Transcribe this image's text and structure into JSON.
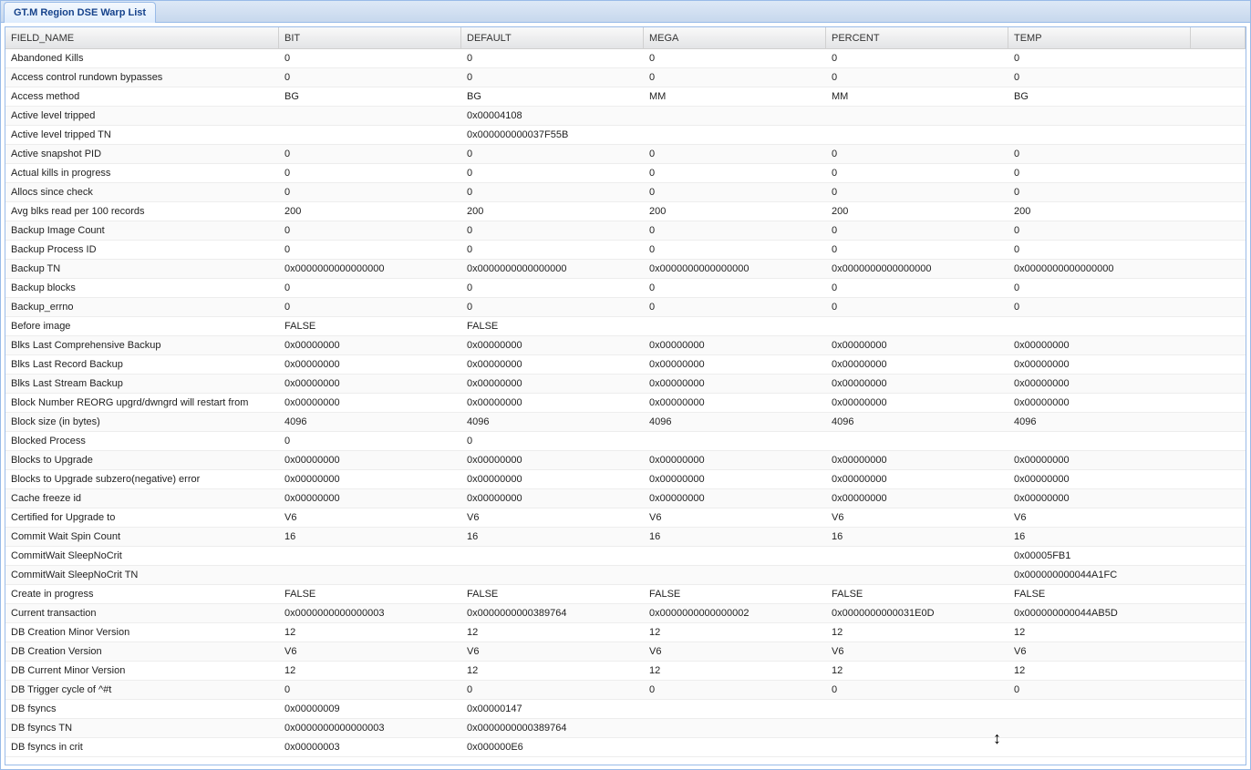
{
  "tab": {
    "title": "GT.M Region DSE Warp List"
  },
  "columns": [
    "FIELD_NAME",
    "BIT",
    "DEFAULT",
    "MEGA",
    "PERCENT",
    "TEMP"
  ],
  "rows": [
    {
      "f": "Abandoned Kills",
      "v": [
        "0",
        "0",
        "0",
        "0",
        "0"
      ]
    },
    {
      "f": "Access control rundown bypasses",
      "v": [
        "0",
        "0",
        "0",
        "0",
        "0"
      ]
    },
    {
      "f": "Access method",
      "v": [
        "BG",
        "BG",
        "MM",
        "MM",
        "BG"
      ]
    },
    {
      "f": "Active level tripped",
      "v": [
        "",
        "0x00004108",
        "",
        "",
        ""
      ]
    },
    {
      "f": "Active level tripped TN",
      "v": [
        "",
        "0x000000000037F55B",
        "",
        "",
        ""
      ]
    },
    {
      "f": "Active snapshot PID",
      "v": [
        "0",
        "0",
        "0",
        "0",
        "0"
      ]
    },
    {
      "f": "Actual kills in progress",
      "v": [
        "0",
        "0",
        "0",
        "0",
        "0"
      ]
    },
    {
      "f": "Allocs since check",
      "v": [
        "0",
        "0",
        "0",
        "0",
        "0"
      ]
    },
    {
      "f": "Avg blks read per 100 records",
      "v": [
        "200",
        "200",
        "200",
        "200",
        "200"
      ]
    },
    {
      "f": "Backup Image Count",
      "v": [
        "0",
        "0",
        "0",
        "0",
        "0"
      ]
    },
    {
      "f": "Backup Process ID",
      "v": [
        "0",
        "0",
        "0",
        "0",
        "0"
      ]
    },
    {
      "f": "Backup TN",
      "v": [
        "0x0000000000000000",
        "0x0000000000000000",
        "0x0000000000000000",
        "0x0000000000000000",
        "0x0000000000000000"
      ]
    },
    {
      "f": "Backup blocks",
      "v": [
        "0",
        "0",
        "0",
        "0",
        "0"
      ]
    },
    {
      "f": "Backup_errno",
      "v": [
        "0",
        "0",
        "0",
        "0",
        "0"
      ]
    },
    {
      "f": "Before image",
      "v": [
        "FALSE",
        "FALSE",
        "",
        "",
        ""
      ]
    },
    {
      "f": "Blks Last Comprehensive Backup",
      "v": [
        "0x00000000",
        "0x00000000",
        "0x00000000",
        "0x00000000",
        "0x00000000"
      ]
    },
    {
      "f": "Blks Last Record Backup",
      "v": [
        "0x00000000",
        "0x00000000",
        "0x00000000",
        "0x00000000",
        "0x00000000"
      ]
    },
    {
      "f": "Blks Last Stream Backup",
      "v": [
        "0x00000000",
        "0x00000000",
        "0x00000000",
        "0x00000000",
        "0x00000000"
      ]
    },
    {
      "f": "Block Number REORG upgrd/dwngrd will restart from",
      "v": [
        "0x00000000",
        "0x00000000",
        "0x00000000",
        "0x00000000",
        "0x00000000"
      ]
    },
    {
      "f": "Block size (in bytes)",
      "v": [
        "4096",
        "4096",
        "4096",
        "4096",
        "4096"
      ]
    },
    {
      "f": "Blocked Process",
      "v": [
        "0",
        "0",
        "",
        "",
        ""
      ]
    },
    {
      "f": "Blocks to Upgrade",
      "v": [
        "0x00000000",
        "0x00000000",
        "0x00000000",
        "0x00000000",
        "0x00000000"
      ]
    },
    {
      "f": "Blocks to Upgrade subzero(negative) error",
      "v": [
        "0x00000000",
        "0x00000000",
        "0x00000000",
        "0x00000000",
        "0x00000000"
      ]
    },
    {
      "f": "Cache freeze id",
      "v": [
        "0x00000000",
        "0x00000000",
        "0x00000000",
        "0x00000000",
        "0x00000000"
      ]
    },
    {
      "f": "Certified for Upgrade to",
      "v": [
        "V6",
        "V6",
        "V6",
        "V6",
        "V6"
      ]
    },
    {
      "f": "Commit Wait Spin Count",
      "v": [
        "16",
        "16",
        "16",
        "16",
        "16"
      ]
    },
    {
      "f": "CommitWait SleepNoCrit",
      "v": [
        "",
        "",
        "",
        "",
        "0x00005FB1"
      ]
    },
    {
      "f": "CommitWait SleepNoCrit TN",
      "v": [
        "",
        "",
        "",
        "",
        "0x000000000044A1FC"
      ]
    },
    {
      "f": "Create in progress",
      "v": [
        "FALSE",
        "FALSE",
        "FALSE",
        "FALSE",
        "FALSE"
      ]
    },
    {
      "f": "Current transaction",
      "v": [
        "0x0000000000000003",
        "0x0000000000389764",
        "0x0000000000000002",
        "0x0000000000031E0D",
        "0x000000000044AB5D"
      ]
    },
    {
      "f": "DB Creation Minor Version",
      "v": [
        "12",
        "12",
        "12",
        "12",
        "12"
      ]
    },
    {
      "f": "DB Creation Version",
      "v": [
        "V6",
        "V6",
        "V6",
        "V6",
        "V6"
      ]
    },
    {
      "f": "DB Current Minor Version",
      "v": [
        "12",
        "12",
        "12",
        "12",
        "12"
      ]
    },
    {
      "f": "DB Trigger cycle of ^#t",
      "v": [
        "0",
        "0",
        "0",
        "0",
        "0"
      ]
    },
    {
      "f": "DB fsyncs",
      "v": [
        "0x00000009",
        "0x00000147",
        "",
        "",
        ""
      ]
    },
    {
      "f": "DB fsyncs TN",
      "v": [
        "0x0000000000000003",
        "0x0000000000389764",
        "",
        "",
        ""
      ]
    },
    {
      "f": "DB fsyncs in crit",
      "v": [
        "0x00000003",
        "0x000000E6",
        "",
        "",
        ""
      ]
    }
  ],
  "cursor": {
    "glyph": "↕"
  }
}
